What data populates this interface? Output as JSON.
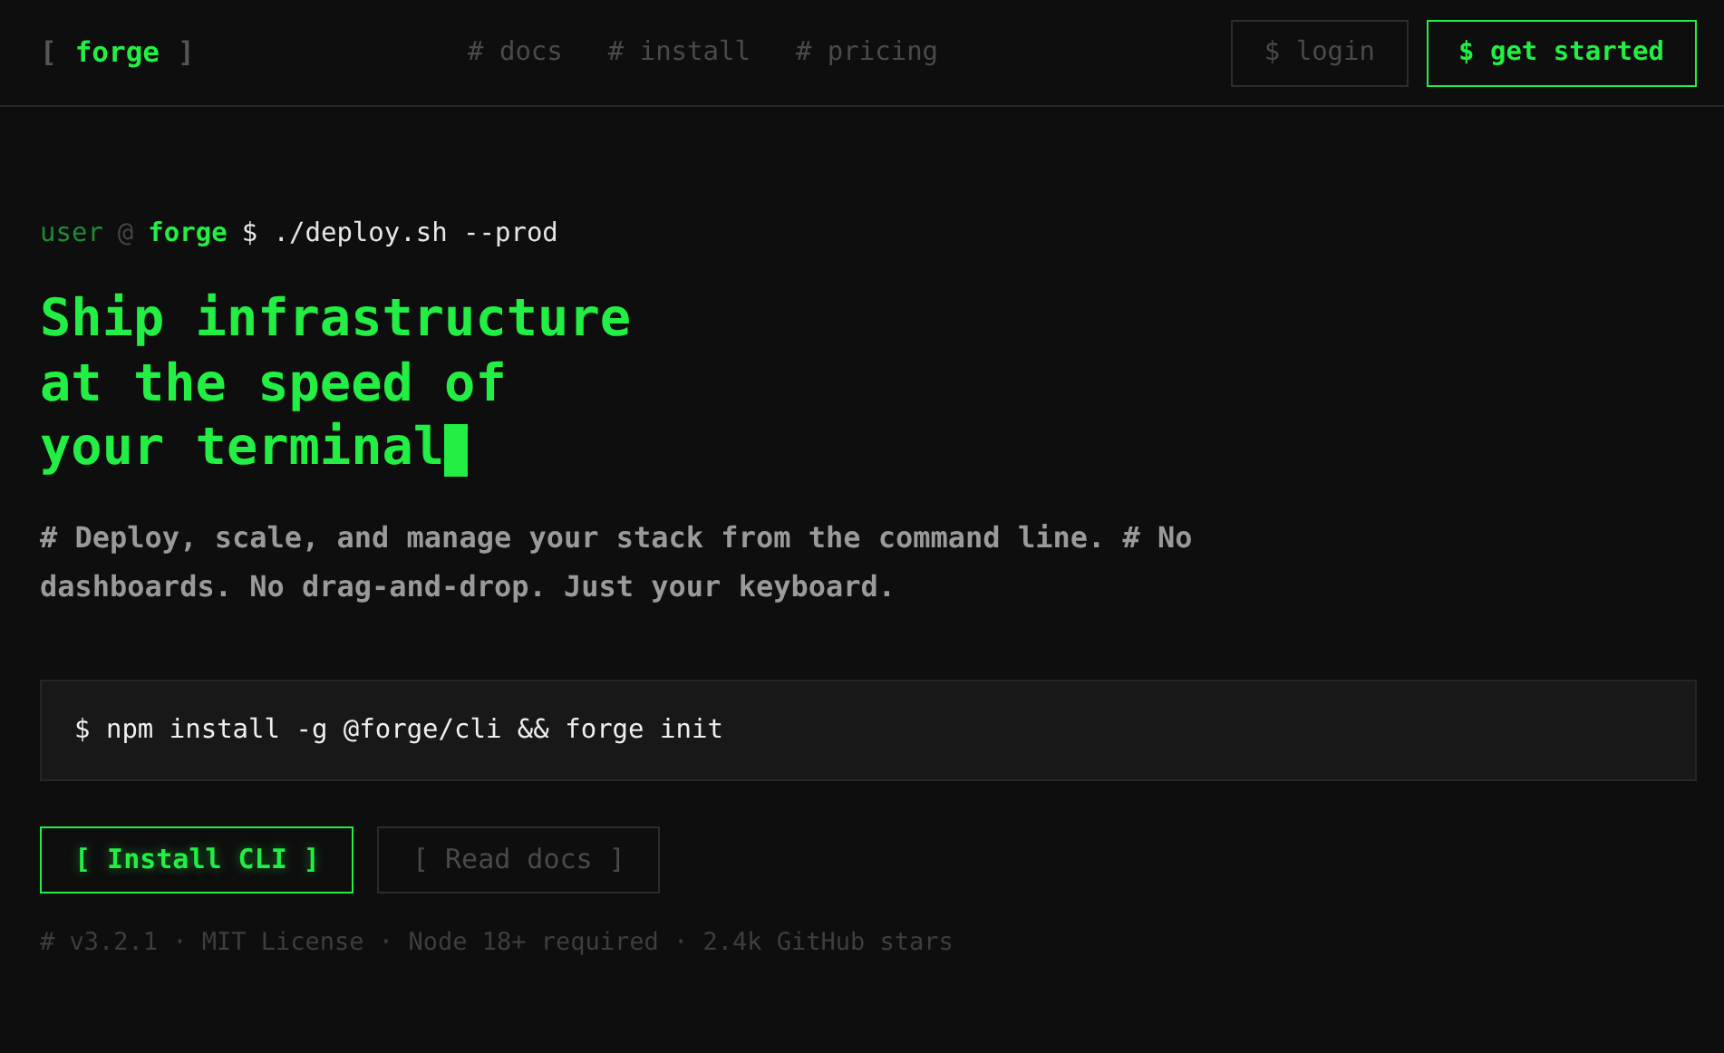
{
  "header": {
    "logo": {
      "open": "[",
      "name": "forge",
      "close": "]"
    },
    "nav": [
      "# docs",
      "# install",
      "# pricing"
    ],
    "buttons": [
      {
        "label": "$ login",
        "kind": "secondary"
      },
      {
        "label": "$ get started",
        "kind": "primary"
      }
    ]
  },
  "hero": {
    "prompt": {
      "user": "user",
      "at": "@",
      "host": "forge",
      "command": "$ ./deploy.sh --prod"
    },
    "headline": [
      "Ship infrastructure",
      "at the speed of",
      "your terminal"
    ],
    "cursor": true,
    "description": "# Deploy, scale, and manage your stack from the command line. # No dashboards. No drag-and-drop. Just your keyboard.",
    "install_command": "$ npm install -g @forge/cli && forge init",
    "actions": [
      {
        "label": "[ Install CLI ]",
        "kind": "primary"
      },
      {
        "label": "[ Read docs ]",
        "kind": "secondary"
      }
    ],
    "meta": "# v3.2.1 · MIT License · Node 18+ required · 2.4k GitHub stars"
  }
}
